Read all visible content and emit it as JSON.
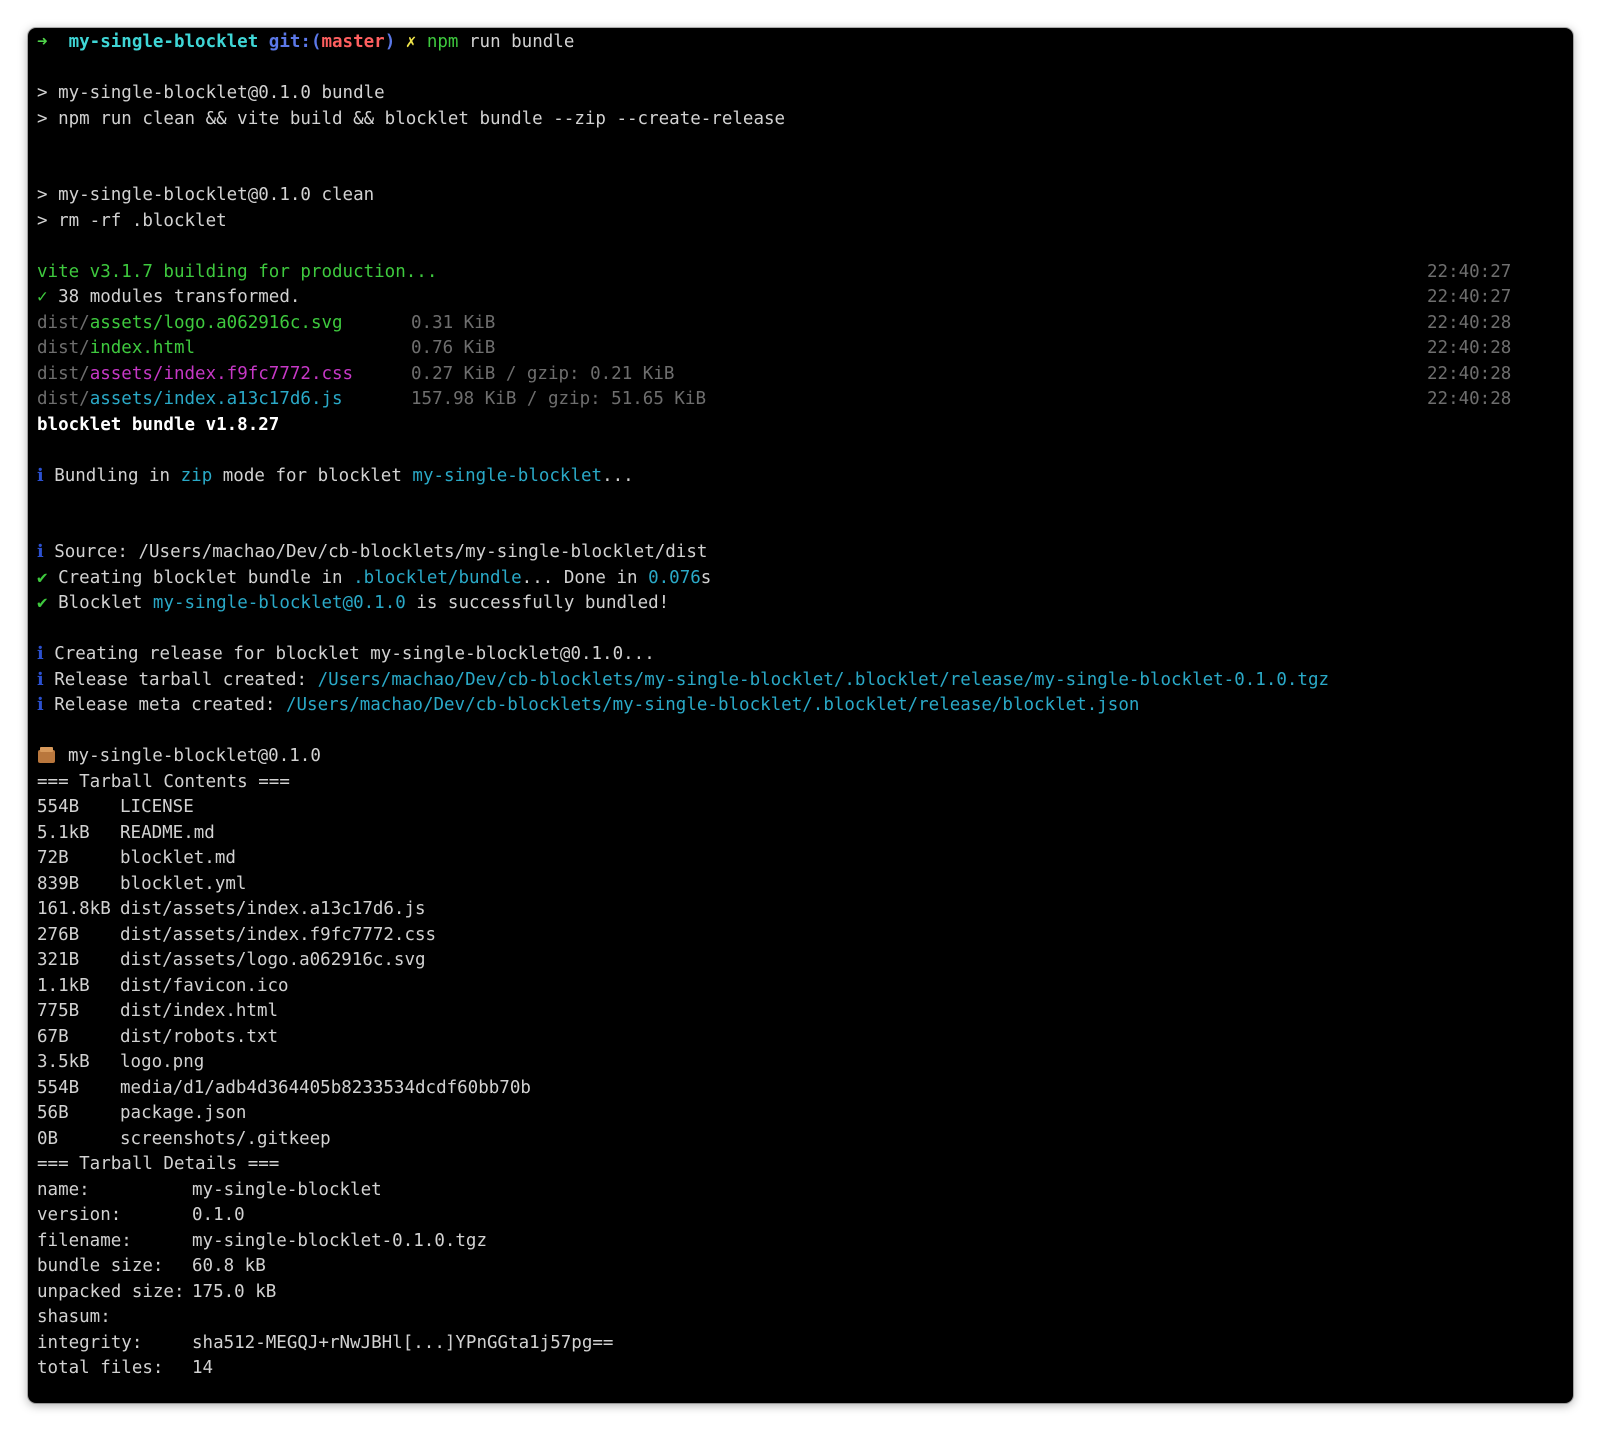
{
  "colors": {
    "background": "#000000",
    "text": "#d2d2d2",
    "white_bold": "#ffffff",
    "prompt_arrow": "#4fd54a",
    "cyan_bold": "#3fd6d6",
    "git_blue": "#5b78e8",
    "git_branch": "#ff5f5f",
    "yellow": "#f0e54a",
    "green": "#3ec93e",
    "cyan": "#2aa9c7",
    "magenta": "#c638c6",
    "gray": "#6e6e6e",
    "info_blue": "#2b50d0"
  },
  "lines": [
    {
      "segments": [
        {
          "text": "➜  ",
          "color": "prompt_arrow",
          "bold": true
        },
        {
          "text": "my-single-blocklet",
          "color": "cyan_bold",
          "bold": true
        },
        {
          "text": " git:(",
          "color": "git_blue",
          "bold": true
        },
        {
          "text": "master",
          "color": "git_branch",
          "bold": true
        },
        {
          "text": ")",
          "color": "git_blue",
          "bold": true
        },
        {
          "text": " ✗ ",
          "color": "yellow",
          "bold": true
        },
        {
          "text": "npm",
          "color": "green"
        },
        {
          "text": " run bundle",
          "color": "text"
        }
      ]
    },
    {
      "segments": []
    },
    {
      "segments": [
        {
          "text": "> my-single-blocklet@0.1.0 bundle"
        }
      ]
    },
    {
      "segments": [
        {
          "text": "> npm run clean && vite build && blocklet bundle --zip --create-release"
        }
      ]
    },
    {
      "segments": []
    },
    {
      "segments": []
    },
    {
      "segments": [
        {
          "text": "> my-single-blocklet@0.1.0 clean"
        }
      ]
    },
    {
      "segments": [
        {
          "text": "> rm -rf .blocklet"
        }
      ]
    },
    {
      "segments": []
    },
    {
      "segments": [
        {
          "text": "vite v3.1.7 building for production...",
          "color": "green"
        }
      ],
      "ts": "22:40:27"
    },
    {
      "segments": [
        {
          "text": "✓",
          "color": "green"
        },
        {
          "text": " 38 modules transformed."
        }
      ],
      "ts": "22:40:27"
    },
    {
      "segments": [
        {
          "text": "dist/",
          "color": "gray"
        },
        {
          "text": "assets/logo.a062916c.svg",
          "color": "green"
        }
      ],
      "size": "0.31 KiB",
      "ts": "22:40:28"
    },
    {
      "segments": [
        {
          "text": "dist/",
          "color": "gray"
        },
        {
          "text": "index.html",
          "color": "green"
        }
      ],
      "size": "0.76 KiB",
      "ts": "22:40:28"
    },
    {
      "segments": [
        {
          "text": "dist/",
          "color": "gray"
        },
        {
          "text": "assets/index.f9fc7772.css",
          "color": "magenta"
        }
      ],
      "size": "0.27 KiB / gzip: 0.21 KiB",
      "ts": "22:40:28"
    },
    {
      "segments": [
        {
          "text": "dist/",
          "color": "gray"
        },
        {
          "text": "assets/index.a13c17d6.js",
          "color": "cyan"
        }
      ],
      "size": "157.98 KiB / gzip: 51.65 KiB",
      "ts": "22:40:28"
    },
    {
      "segments": [
        {
          "text": "blocklet bundle v1.8.27",
          "color": "white_bold",
          "bold": true
        }
      ]
    },
    {
      "segments": []
    },
    {
      "segments": [
        {
          "text": "ℹ",
          "color": "info_blue"
        },
        {
          "text": " Bundling in "
        },
        {
          "text": "zip",
          "color": "cyan"
        },
        {
          "text": " mode for blocklet "
        },
        {
          "text": "my-single-blocklet",
          "color": "cyan"
        },
        {
          "text": "..."
        }
      ]
    },
    {
      "segments": []
    },
    {
      "segments": []
    },
    {
      "segments": [
        {
          "text": "ℹ",
          "color": "info_blue"
        },
        {
          "text": " Source: /Users/machao/Dev/cb-blocklets/my-single-blocklet/dist"
        }
      ]
    },
    {
      "segments": [
        {
          "text": "✔",
          "color": "green"
        },
        {
          "text": " Creating blocklet bundle in "
        },
        {
          "text": ".blocklet/bundle",
          "color": "cyan"
        },
        {
          "text": "... Done in "
        },
        {
          "text": "0.076",
          "color": "cyan"
        },
        {
          "text": "s"
        }
      ]
    },
    {
      "segments": [
        {
          "text": "✔",
          "color": "green"
        },
        {
          "text": " Blocklet "
        },
        {
          "text": "my-single-blocklet@0.1.0",
          "color": "cyan"
        },
        {
          "text": " is successfully bundled!"
        }
      ]
    },
    {
      "segments": []
    },
    {
      "segments": [
        {
          "text": "ℹ",
          "color": "info_blue"
        },
        {
          "text": " Creating release for blocklet my-single-blocklet@0.1.0..."
        }
      ]
    },
    {
      "segments": [
        {
          "text": "ℹ",
          "color": "info_blue"
        },
        {
          "text": " Release tarball created: "
        },
        {
          "text": "/Users/machao/Dev/cb-blocklets/my-single-blocklet/.blocklet/release/my-single-blocklet-0.1.0.tgz",
          "color": "cyan"
        }
      ]
    },
    {
      "segments": [
        {
          "text": "ℹ",
          "color": "info_blue"
        },
        {
          "text": " Release meta created: "
        },
        {
          "text": "/Users/machao/Dev/cb-blocklets/my-single-blocklet/.blocklet/release/blocklet.json",
          "color": "cyan"
        }
      ]
    },
    {
      "segments": []
    },
    {
      "emoji": "package-icon",
      "segments": [
        {
          "text": "my-single-blocklet@0.1.0"
        }
      ]
    },
    {
      "segments": [
        {
          "text": "=== Tarball Contents ==="
        }
      ]
    },
    {
      "segments": [
        {
          "text": "554B"
        }
      ],
      "file": "LICENSE"
    },
    {
      "segments": [
        {
          "text": "5.1kB"
        }
      ],
      "file": "README.md"
    },
    {
      "segments": [
        {
          "text": "72B"
        }
      ],
      "file": "blocklet.md"
    },
    {
      "segments": [
        {
          "text": "839B"
        }
      ],
      "file": "blocklet.yml"
    },
    {
      "segments": [
        {
          "text": "161.8kB"
        }
      ],
      "file": "dist/assets/index.a13c17d6.js"
    },
    {
      "segments": [
        {
          "text": "276B"
        }
      ],
      "file": "dist/assets/index.f9fc7772.css"
    },
    {
      "segments": [
        {
          "text": "321B"
        }
      ],
      "file": "dist/assets/logo.a062916c.svg"
    },
    {
      "segments": [
        {
          "text": "1.1kB"
        }
      ],
      "file": "dist/favicon.ico"
    },
    {
      "segments": [
        {
          "text": "775B"
        }
      ],
      "file": "dist/index.html"
    },
    {
      "segments": [
        {
          "text": "67B"
        }
      ],
      "file": "dist/robots.txt"
    },
    {
      "segments": [
        {
          "text": "3.5kB"
        }
      ],
      "file": "logo.png"
    },
    {
      "segments": [
        {
          "text": "554B"
        }
      ],
      "file": "media/d1/adb4d364405b8233534dcdf60bb70b"
    },
    {
      "segments": [
        {
          "text": "56B"
        }
      ],
      "file": "package.json"
    },
    {
      "segments": [
        {
          "text": "0B"
        }
      ],
      "file": "screenshots/.gitkeep"
    },
    {
      "segments": [
        {
          "text": "=== Tarball Details ==="
        }
      ]
    },
    {
      "segments": [
        {
          "text": "name:"
        }
      ],
      "val": "my-single-blocklet"
    },
    {
      "segments": [
        {
          "text": "version:"
        }
      ],
      "val": "0.1.0"
    },
    {
      "segments": [
        {
          "text": "filename:"
        }
      ],
      "val": "my-single-blocklet-0.1.0.tgz"
    },
    {
      "segments": [
        {
          "text": "bundle size:"
        }
      ],
      "val": "60.8 kB"
    },
    {
      "segments": [
        {
          "text": "unpacked size:"
        }
      ],
      "val": "175.0 kB"
    },
    {
      "segments": [
        {
          "text": "shasum:"
        }
      ]
    },
    {
      "segments": [
        {
          "text": "integrity:"
        }
      ],
      "val": "sha512-MEGQJ+rNwJBHl[...]YPnGGta1j57pg=="
    },
    {
      "segments": [
        {
          "text": "total files:"
        }
      ],
      "val": "14"
    }
  ]
}
